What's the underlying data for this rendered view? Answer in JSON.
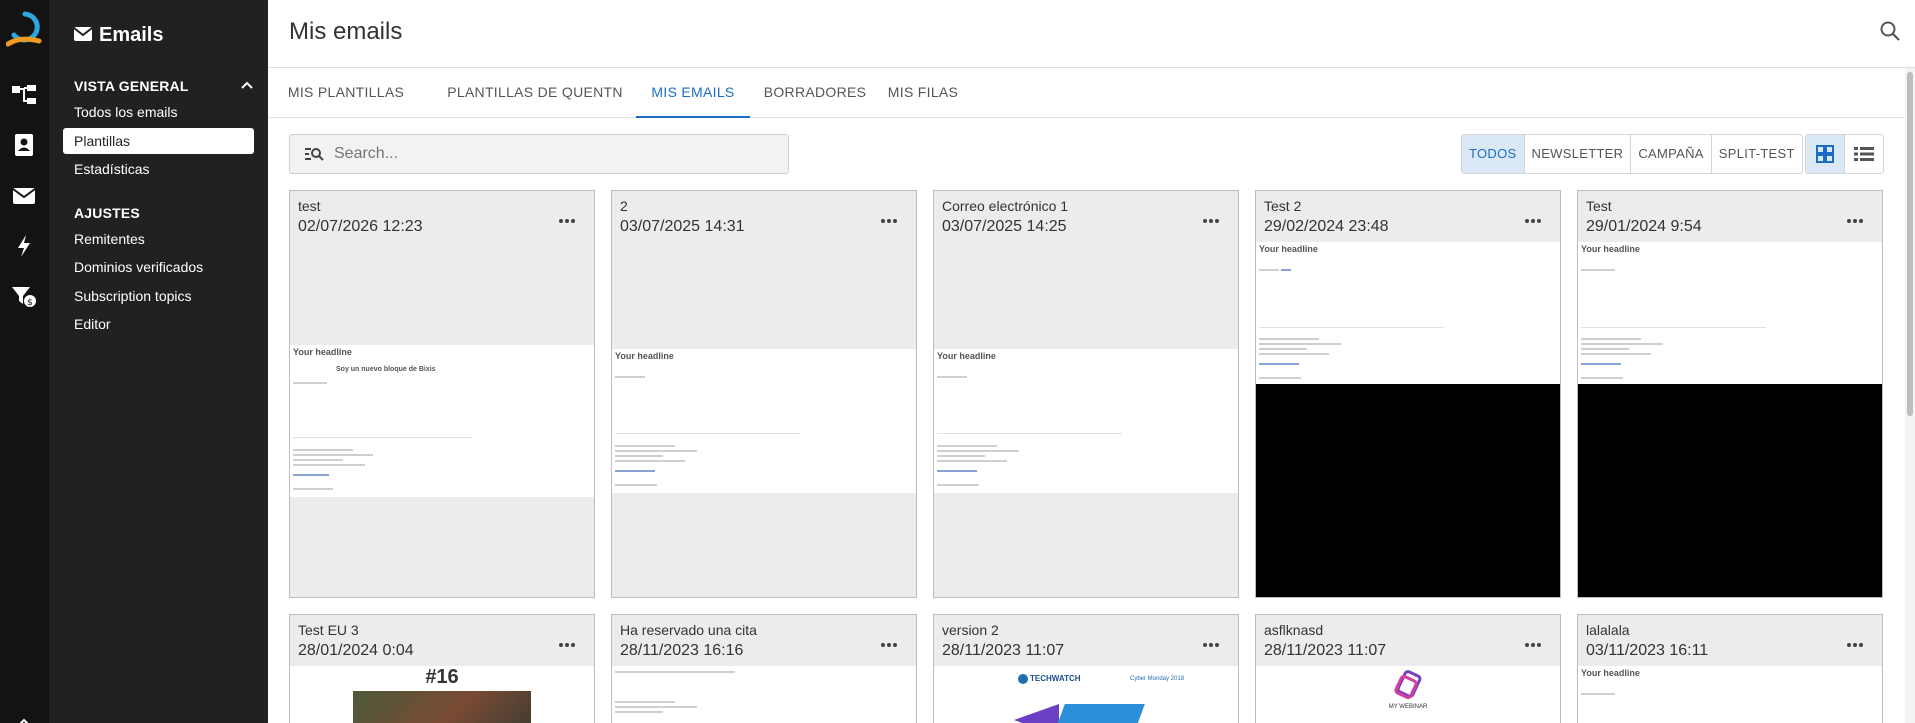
{
  "app": {
    "title": "Emails"
  },
  "sidebar": {
    "title": "Emails",
    "sections": [
      {
        "label": "VISTA GENERAL",
        "items": [
          "Todos los emails",
          "Plantillas",
          "Estadísticas"
        ]
      },
      {
        "label": "AJUSTES",
        "items": [
          "Remitentes",
          "Dominios verificados",
          "Subscription topics",
          "Editor"
        ]
      }
    ],
    "active_item": "Plantillas"
  },
  "rail": {
    "icons": [
      "quentn-logo-icon",
      "flow-icon",
      "contacts-icon",
      "mail-icon",
      "bolt-icon",
      "funnel-money-icon",
      "chevron-up-icon"
    ]
  },
  "header": {
    "title": "Mis emails"
  },
  "tabs": [
    "MIS PLANTILLAS",
    "PLANTILLAS DE QUENTN",
    "MIS EMAILS",
    "BORRADORES",
    "MIS FILAS"
  ],
  "active_tab": "MIS EMAILS",
  "search": {
    "placeholder": "Search..."
  },
  "filters": [
    "TODOS",
    "NEWSLETTER",
    "CAMPAÑA",
    "SPLIT-TEST"
  ],
  "active_filter": "TODOS",
  "preview_text": {
    "headline": "Your headline",
    "block": "Soy un nuevo bloque de Bixis"
  },
  "cards": [
    {
      "name": "test",
      "date": "02/07/2026 12:23"
    },
    {
      "name": "2",
      "date": "03/07/2025 14:31"
    },
    {
      "name": "Correo electrónico 1",
      "date": "03/07/2025 14:25"
    },
    {
      "name": "Test 2",
      "date": "29/02/2024 23:48"
    },
    {
      "name": "Test",
      "date": "29/01/2024 9:54"
    },
    {
      "name": "Test EU 3",
      "date": "28/01/2024 0:04"
    },
    {
      "name": "Ha reservado una cita",
      "date": "28/11/2023 16:16"
    },
    {
      "name": "version 2",
      "date": "28/11/2023 11:07"
    },
    {
      "name": "asflknasd",
      "date": "28/11/2023 11:07"
    },
    {
      "name": "lalalala",
      "date": "03/11/2023 16:11"
    }
  ],
  "card_previews": {
    "issue_number": "#16",
    "techwatch": "TECHWATCH",
    "cyber_monday": "Cyber Monday 2018",
    "webinar": "MY WEBINAR"
  },
  "colors": {
    "accent": "#1a6fc4",
    "sidebar_bg": "#212121",
    "rail_bg": "#131313",
    "logo_orange": "#f29a1f",
    "logo_blue": "#2aa7df"
  }
}
